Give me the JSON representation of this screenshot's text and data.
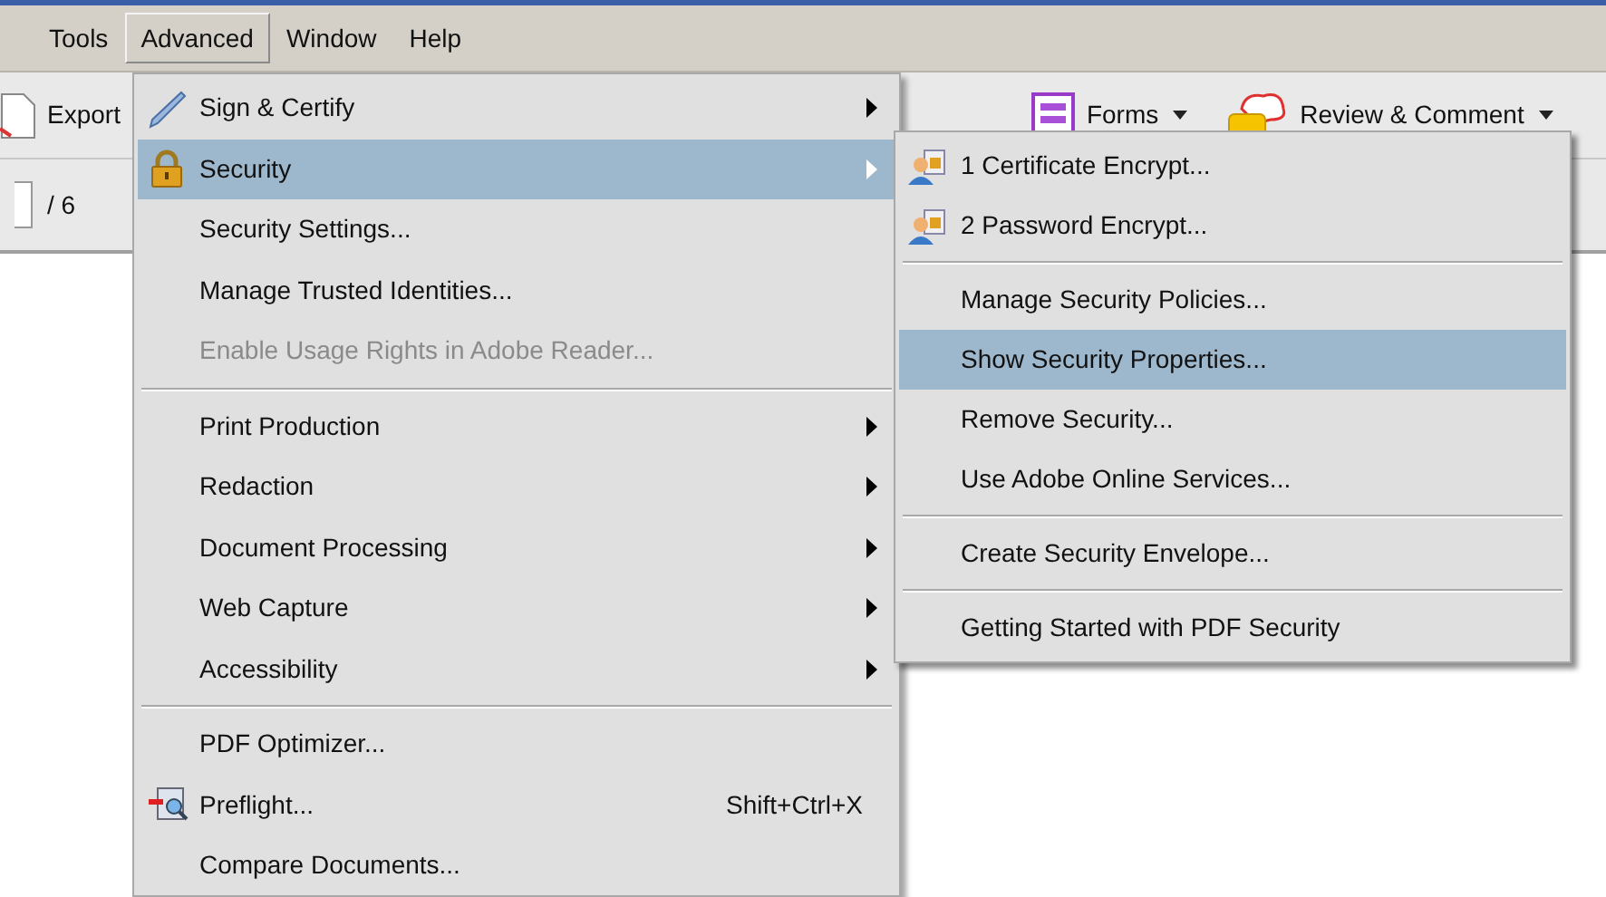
{
  "menu_bar": [
    {
      "label": "Tools",
      "selected": false
    },
    {
      "label": "Advanced",
      "selected": true
    },
    {
      "label": "Window",
      "selected": false
    },
    {
      "label": "Help",
      "selected": false
    }
  ],
  "toolbar": {
    "buttons": [
      {
        "label": "Export",
        "kind": "export",
        "dropdown": false
      },
      {
        "label": "Forms",
        "kind": "forms",
        "dropdown": true
      },
      {
        "label": "Review & Comment",
        "kind": "review",
        "dropdown": true
      }
    ],
    "page_count": "/ 6"
  },
  "advanced_menu": [
    {
      "kind": "pen",
      "label": "Sign & Certify",
      "submenu": true,
      "selected": false,
      "disabled": false
    },
    {
      "kind": "lock",
      "label": "Security",
      "submenu": true,
      "selected": true,
      "disabled": false
    },
    {
      "kind": "item",
      "label": "Security Settings...",
      "submenu": false,
      "selected": false,
      "disabled": false
    },
    {
      "kind": "item",
      "label": "Manage Trusted Identities...",
      "submenu": false,
      "selected": false,
      "disabled": false
    },
    {
      "kind": "item",
      "label": "Enable Usage Rights in Adobe Reader...",
      "submenu": false,
      "selected": false,
      "disabled": true
    },
    {
      "kind": "separator"
    },
    {
      "kind": "item",
      "label": "Print Production",
      "submenu": true,
      "selected": false,
      "disabled": false
    },
    {
      "kind": "item",
      "label": "Redaction",
      "submenu": true,
      "selected": false,
      "disabled": false
    },
    {
      "kind": "item",
      "label": "Document Processing",
      "submenu": true,
      "selected": false,
      "disabled": false
    },
    {
      "kind": "item",
      "label": "Web Capture",
      "submenu": true,
      "selected": false,
      "disabled": false
    },
    {
      "kind": "item",
      "label": "Accessibility",
      "submenu": true,
      "selected": false,
      "disabled": false
    },
    {
      "kind": "separator"
    },
    {
      "kind": "item",
      "label": "PDF Optimizer...",
      "submenu": false,
      "selected": false,
      "disabled": false
    },
    {
      "kind": "preflight",
      "label": "Preflight...",
      "shortcut": "Shift+Ctrl+X",
      "submenu": false,
      "selected": false,
      "disabled": false
    },
    {
      "kind": "item",
      "label": "Compare Documents...",
      "submenu": false,
      "selected": false,
      "disabled": false
    }
  ],
  "security_submenu": [
    {
      "kind": "person-lock",
      "label": "1 Certificate Encrypt...",
      "selected": false
    },
    {
      "kind": "person-lock",
      "label": "2 Password Encrypt...",
      "selected": false
    },
    {
      "kind": "separator"
    },
    {
      "kind": "item",
      "label": "Manage Security Policies...",
      "selected": false
    },
    {
      "kind": "item",
      "label": "Show Security Properties...",
      "selected": true
    },
    {
      "kind": "item",
      "label": "Remove Security...",
      "selected": false
    },
    {
      "kind": "item",
      "label": "Use Adobe Online Services...",
      "selected": false
    },
    {
      "kind": "separator"
    },
    {
      "kind": "item",
      "label": "Create Security Envelope...",
      "selected": false
    },
    {
      "kind": "separator"
    },
    {
      "kind": "item",
      "label": "Getting Started with PDF Security",
      "selected": false
    }
  ]
}
